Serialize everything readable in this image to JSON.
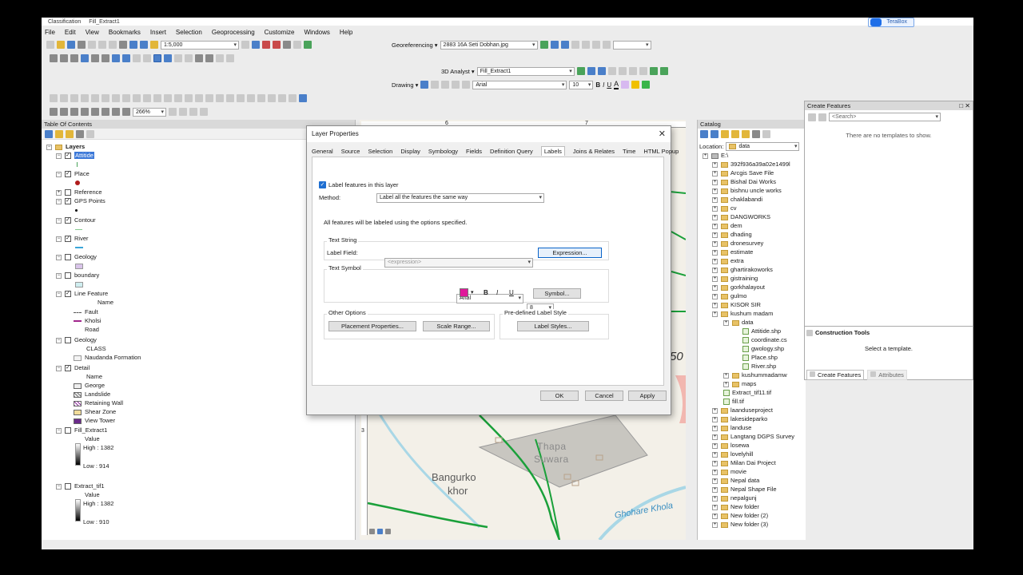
{
  "app": {
    "title_left": "Classification",
    "title_doc": "Fill_Extract1",
    "terabox": "TeraBox"
  },
  "menu": [
    "File",
    "Edit",
    "View",
    "Bookmarks",
    "Insert",
    "Selection",
    "Geoprocessing",
    "Customize",
    "Windows",
    "Help"
  ],
  "toolbar": {
    "scale": "1:5,000",
    "georeferencing_label": "Georeferencing ▾",
    "georef_layer": "2883 16A Seti Dobhan.jpg",
    "analyst_label": "3D Analyst ▾",
    "analyst_layer": "Fill_Extract1",
    "drawing_label": "Drawing ▾",
    "font": "Arial",
    "font_size": "10",
    "zoom": "266%"
  },
  "toc": {
    "title": "Table Of Contents",
    "root": "Layers",
    "rows": [
      {
        "label": "Attitide",
        "checked": true,
        "selected": true
      },
      {
        "label": "Place",
        "checked": true
      },
      {
        "label": "Reference",
        "checked": false
      },
      {
        "label": "GPS Points",
        "checked": true
      },
      {
        "label": "Contour",
        "checked": true
      },
      {
        "label": "River",
        "checked": true
      },
      {
        "label": "Geology",
        "checked": false
      },
      {
        "label": "boundary",
        "checked": false
      },
      {
        "label": "Line Feature",
        "checked": true
      },
      {
        "label": "Geology",
        "checked": false
      },
      {
        "label": "Detail",
        "checked": true
      },
      {
        "label": "Fill_Extract1",
        "checked": false
      },
      {
        "label": "Extract_tif1",
        "checked": false
      }
    ],
    "line_feature_sub": [
      "Name",
      "Fault",
      "Kholsi",
      "Road"
    ],
    "geology_sub": [
      "CLASS",
      "Naudanda Formation"
    ],
    "detail_sub": [
      "Name",
      "George",
      "Landslide",
      "Retaining Wall",
      "Shear Zone",
      "View Tower"
    ],
    "fill_sub": {
      "value": "Value",
      "high": "High : 1382",
      "low": "Low : 914"
    },
    "extract_sub": {
      "value": "Value",
      "high": "High : 1382",
      "low": "Low : 910"
    }
  },
  "map": {
    "labels": [
      "Thapa",
      "Suwara",
      "Bangurko",
      "khor",
      "Ghohare Khola",
      "50"
    ],
    "ruler": [
      "6",
      "7"
    ],
    "ruler_left": "3"
  },
  "dialog": {
    "title": "Layer Properties",
    "tabs": [
      "General",
      "Source",
      "Selection",
      "Display",
      "Symbology",
      "Fields",
      "Definition Query",
      "Labels",
      "Joins & Relates",
      "Time",
      "HTML Popup"
    ],
    "active_tab": "Labels",
    "label_features": "Label features in this layer",
    "method_label": "Method:",
    "method_value": "Label all the features the same way",
    "info": "All features will be labeled using the options specified.",
    "text_string_group": "Text String",
    "label_field_label": "Label Field:",
    "label_field_value": "<expression>",
    "expression_btn": "Expression...",
    "text_symbol_group": "Text Symbol",
    "font": "Arial",
    "size": "8",
    "symbol_btn": "Symbol...",
    "other_options_group": "Other Options",
    "placement_btn": "Placement Properties...",
    "scale_range_btn": "Scale Range...",
    "predefined_group": "Pre-defined Label Style",
    "label_styles_btn": "Label Styles...",
    "ok": "OK",
    "cancel": "Cancel",
    "apply": "Apply",
    "colors": {
      "text_color": "#e0189a"
    }
  },
  "catalog": {
    "title": "Catalog",
    "location_label": "Location:",
    "location_value": "data",
    "root": "E:\\",
    "folders": [
      "392f936a39a02e1499l",
      "Arcgis Save File",
      "Bishal Dai Works",
      "bishnu uncle works",
      "chaklabandi",
      "cv",
      "DANGWORKS",
      "dem",
      "dhading",
      "dronesurvey",
      "estimate",
      "extra",
      "ghartirakoworks",
      "gistraining",
      "gorkhalayout",
      "gulmo",
      "KISOR SIR",
      "kushum madam"
    ],
    "data_folder": "data",
    "data_files": [
      "Attitide.shp",
      "coordinate.cs",
      "gwology.shp",
      "Place.shp",
      "River.shp"
    ],
    "after_data": [
      "kushummadamw",
      "maps",
      "Extract_tif11.tif",
      "fill.tif"
    ],
    "more_folders": [
      "laanduseproject",
      "lakesideparko",
      "landuse",
      "Langtang DGPS Survey",
      "losewa",
      "lovelyhill",
      "Milan Dai Project",
      "movie",
      "Nepal data",
      "Nepal Shape File",
      "nepalgunj",
      "New folder",
      "New folder (2)",
      "New folder (3)"
    ]
  },
  "create_features": {
    "title": "Create Features",
    "search_placeholder": "<Search>",
    "empty": "There are no templates to show.",
    "construction_title": "Construction Tools",
    "select_template": "Select a template.",
    "tab_create": "Create Features",
    "tab_attributes": "Attributes"
  }
}
